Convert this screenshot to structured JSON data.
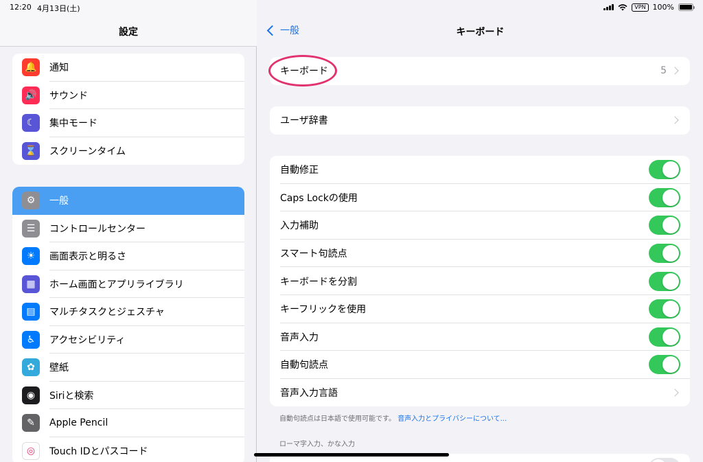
{
  "status": {
    "time": "12:20",
    "date": "4月13日(土)",
    "vpn": "VPN",
    "battery": "100%",
    "battery_level": 1.0
  },
  "sidebar": {
    "title": "設定",
    "group1": [
      {
        "label": "通知",
        "icon": "bell-icon",
        "color": "#ff3b30",
        "glyph": "🔔"
      },
      {
        "label": "サウンド",
        "icon": "speaker-icon",
        "color": "#ff2d55",
        "glyph": "🔊"
      },
      {
        "label": "集中モード",
        "icon": "moon-icon",
        "color": "#5856d6",
        "glyph": "☾"
      },
      {
        "label": "スクリーンタイム",
        "icon": "hourglass-icon",
        "color": "#5856d6",
        "glyph": "⌛"
      }
    ],
    "group2": [
      {
        "label": "一般",
        "icon": "gear-icon",
        "color": "#8e8e93",
        "glyph": "⚙",
        "selected": true
      },
      {
        "label": "コントロールセンター",
        "icon": "toggles-icon",
        "color": "#8e8e93",
        "glyph": "☰"
      },
      {
        "label": "画面表示と明るさ",
        "icon": "sun-icon",
        "color": "#007aff",
        "glyph": "☀"
      },
      {
        "label": "ホーム画面とアプリライブラリ",
        "icon": "app-grid-icon",
        "color": "#5856d6",
        "glyph": "▦"
      },
      {
        "label": "マルチタスクとジェスチャ",
        "icon": "multitask-icon",
        "color": "#007aff",
        "glyph": "▤"
      },
      {
        "label": "アクセシビリティ",
        "icon": "accessibility-icon",
        "color": "#007aff",
        "glyph": "♿"
      },
      {
        "label": "壁紙",
        "icon": "flower-icon",
        "color": "#34aadc",
        "glyph": "✿"
      },
      {
        "label": "Siriと検索",
        "icon": "siri-icon",
        "color": "#1c1c1e",
        "glyph": "◉"
      },
      {
        "label": "Apple Pencil",
        "icon": "pencil-icon",
        "color": "#636366",
        "glyph": "✎"
      },
      {
        "label": "Touch IDとパスコード",
        "icon": "fingerprint-icon",
        "color": "#ffffff",
        "glyph": "◎"
      }
    ]
  },
  "main": {
    "back_label": "一般",
    "title": "キーボード",
    "keyboards": {
      "label": "キーボード",
      "value": "5"
    },
    "user_dict": {
      "label": "ユーザ辞書"
    },
    "toggles": [
      {
        "label": "自動修正",
        "on": true
      },
      {
        "label": "Caps Lockの使用",
        "on": true
      },
      {
        "label": "入力補助",
        "on": true
      },
      {
        "label": "スマート句読点",
        "on": true
      },
      {
        "label": "キーボードを分割",
        "on": true
      },
      {
        "label": "キーフリックを使用",
        "on": true
      },
      {
        "label": "音声入力",
        "on": true
      },
      {
        "label": "自動句読点",
        "on": true
      }
    ],
    "dictation_language": {
      "label": "音声入力言語"
    },
    "footnote_text": "自動句読点は日本語で使用可能です。",
    "footnote_link": "音声入力とプライバシーについて...",
    "section_header": "ローマ字入力、かな入力"
  },
  "colors": {
    "accent": "#1a73e8",
    "toggle_on": "#34c759",
    "highlight": "#e0336f",
    "selected_row": "#4a9ff2"
  }
}
